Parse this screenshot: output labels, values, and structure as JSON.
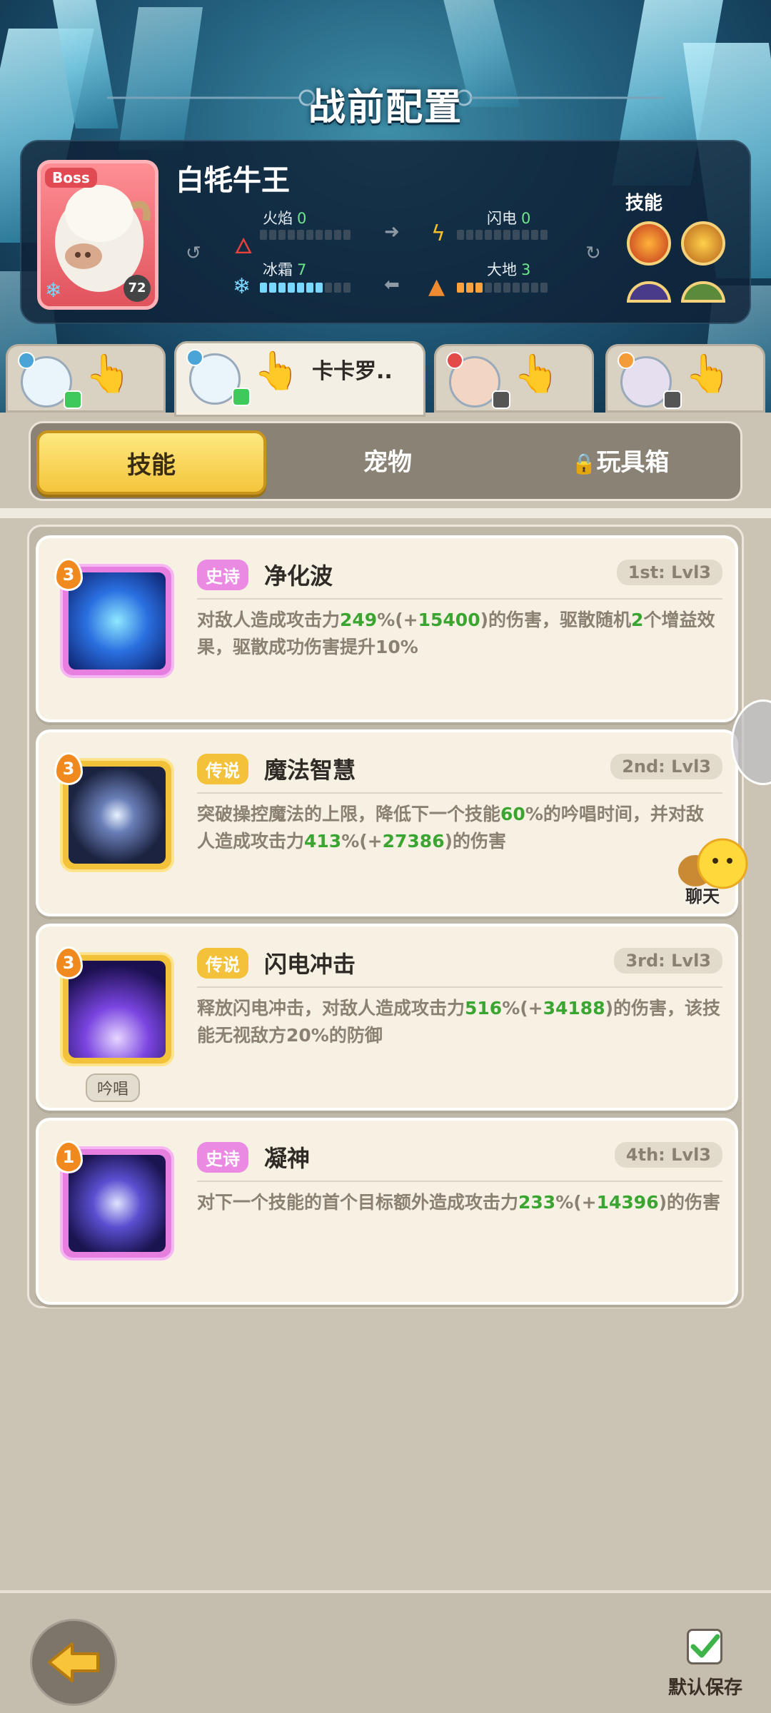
{
  "header": {
    "title": "战前配置"
  },
  "boss": {
    "tag": "Boss",
    "name": "白牦牛王",
    "level": "72",
    "elements": [
      {
        "label": "火焰",
        "value": "0",
        "icon": "fire-icon"
      },
      {
        "label": "闪电",
        "value": "0",
        "icon": "lightning-icon"
      },
      {
        "label": "冰霜",
        "value": "7",
        "icon": "frost-icon"
      },
      {
        "label": "大地",
        "value": "3",
        "icon": "earth-icon"
      }
    ],
    "skills_label": "技能"
  },
  "heroes": [
    {
      "name": "",
      "active": false
    },
    {
      "name": "卡卡罗..",
      "active": true
    },
    {
      "name": "",
      "active": false
    },
    {
      "name": "",
      "active": false
    }
  ],
  "tabs": [
    {
      "label": "技能",
      "active": true
    },
    {
      "label": "宠物",
      "active": false
    },
    {
      "label": "玩具箱",
      "active": false,
      "locked": true
    }
  ],
  "skills": [
    {
      "level": "3",
      "rarity": "史诗",
      "rarity_type": "epic",
      "name": "净化波",
      "rank": "1st: Lvl3",
      "desc_parts": [
        "对敌人造成攻击力",
        "249",
        "%(+",
        "15400",
        ")的伤害，驱散随机",
        "2",
        "个增益效果，驱散成功伤害提升10%"
      ],
      "chant": ""
    },
    {
      "level": "3",
      "rarity": "传说",
      "rarity_type": "legend",
      "name": "魔法智慧",
      "rank": "2nd: Lvl3",
      "desc_parts": [
        "突破操控魔法的上限，降低下一个技能",
        "60",
        "%的吟唱时间，并对敌人造成攻击力",
        "413",
        "%(+",
        "27386",
        ")的伤害"
      ],
      "chant": ""
    },
    {
      "level": "3",
      "rarity": "传说",
      "rarity_type": "legend",
      "name": "闪电冲击",
      "rank": "3rd: Lvl3",
      "desc_parts": [
        "释放闪电冲击，对敌人造成攻击力",
        "516",
        "%(+",
        "34188",
        ")的伤害，该技能无视敌方20%的防御"
      ],
      "chant": "吟唱"
    },
    {
      "level": "1",
      "rarity": "史诗",
      "rarity_type": "epic",
      "name": "凝神",
      "rank": "4th: Lvl3",
      "desc_parts": [
        "对下一个技能的首个目标额外造成攻击力",
        "233",
        "%(+",
        "14396",
        ")的伤害"
      ],
      "chant": ""
    }
  ],
  "side": {
    "chat_label": "聊天"
  },
  "bottom": {
    "save_label": "默认保存"
  }
}
